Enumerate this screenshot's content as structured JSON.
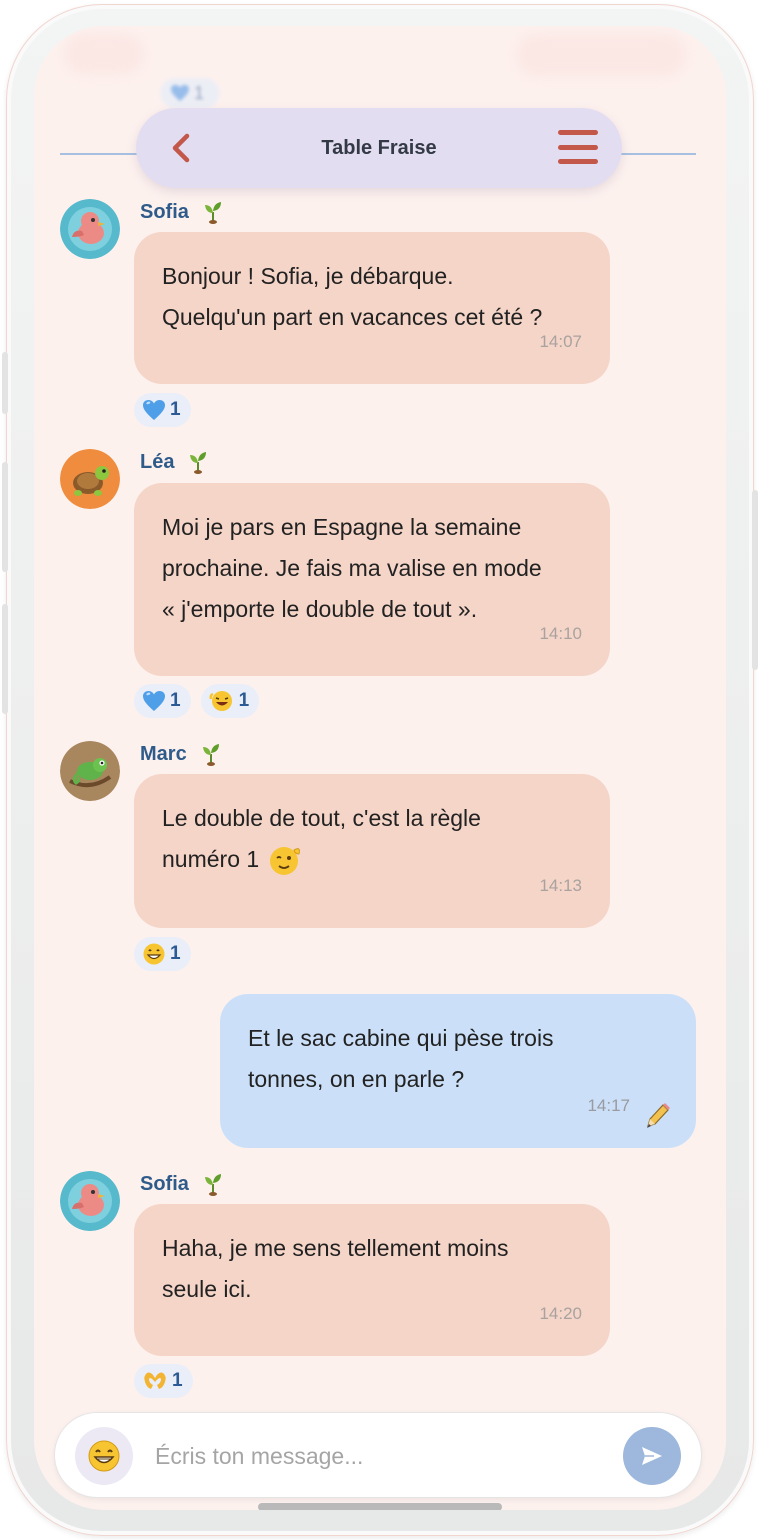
{
  "header": {
    "title": "Table Fraise",
    "back_icon": "chevron-left-icon",
    "menu_icon": "hamburger-menu-icon",
    "accent": "#c2574a"
  },
  "messages": [
    {
      "sender": "Sofia",
      "badge_icon": "sprout-icon",
      "lines": [
        "Bonjour ! Sofia, je débarque.",
        "Quelqu'un part en vacances cet été ?"
      ],
      "time": "14:07",
      "reactions": [
        {
          "icon": "blue-heart-emoji",
          "count": "1"
        }
      ]
    },
    {
      "sender": "Léa",
      "badge_icon": "sprout-icon",
      "lines": [
        "Moi je pars en Espagne la semaine",
        "prochaine. Je fais ma valise en mode",
        "« j'emporte le double de tout »."
      ],
      "time": "14:10",
      "reactions": [
        {
          "icon": "blue-heart-emoji",
          "count": "1"
        },
        {
          "icon": "laughing-emoji",
          "count": "1"
        }
      ]
    },
    {
      "sender": "Marc",
      "badge_icon": "sprout-icon",
      "lines": [
        "Le double de tout, c'est la règle",
        "numéro 1"
      ],
      "time": "14:13",
      "reactions": [
        {
          "icon": "grinning-emoji",
          "count": "1"
        }
      ]
    },
    {
      "sender": "",
      "mine": true,
      "lines": [
        "Et le sac cabine qui pèse trois",
        "tonnes, on en parle ?"
      ],
      "time": "14:17"
    },
    {
      "sender": "Sofia",
      "badge_icon": "sprout-icon",
      "lines": [
        "Haha, je me sens tellement moins",
        "seule ici."
      ],
      "time": "14:20",
      "reactions": [
        {
          "icon": "heart-hands-emoji",
          "count": "1"
        }
      ]
    }
  ],
  "composer": {
    "placeholder": "Écris ton message...",
    "value": ""
  },
  "colors": {
    "screen_bg": "#fdf1ee",
    "bubble_other": "#f5d5c8",
    "bubble_mine": "#cbe0f8",
    "sender_name": "#2f5b8a"
  }
}
